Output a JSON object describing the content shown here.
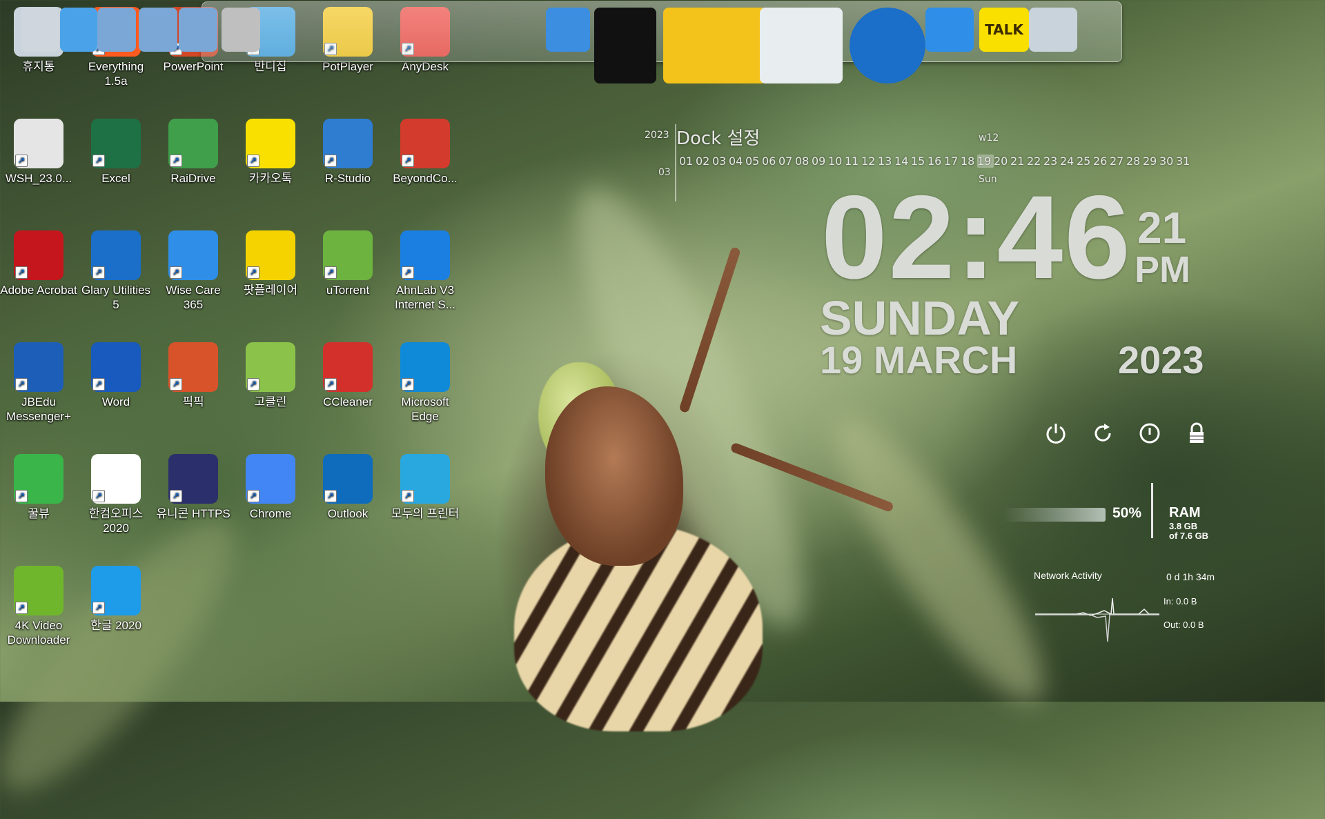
{
  "desktop": {
    "icons": [
      {
        "label": "휴지통",
        "icon": "recycle-bin-icon",
        "color": "#c9d3db"
      },
      {
        "label": "Everything 1.5a",
        "icon": "everything-search-icon",
        "color": "#ff5a1f"
      },
      {
        "label": "PowerPoint",
        "icon": "powerpoint-icon",
        "color": "#d24726"
      },
      {
        "label": "반디집",
        "icon": "bandizip-icon",
        "color": "#3aa0e0"
      },
      {
        "label": "PotPlayer",
        "icon": "potplayer-icon",
        "color": "#f5c518"
      },
      {
        "label": "AnyDesk",
        "icon": "anydesk-icon",
        "color": "#ef443b"
      },
      {
        "label": "WSH_23.0...",
        "icon": "disc-file-icon",
        "color": "#e5e5e5"
      },
      {
        "label": "Excel",
        "icon": "excel-icon",
        "color": "#1e7145"
      },
      {
        "label": "RaiDrive",
        "icon": "raidrive-icon",
        "color": "#3f9f4a"
      },
      {
        "label": "카카오톡",
        "icon": "kakaotalk-icon",
        "color": "#f9e000"
      },
      {
        "label": "R-Studio",
        "icon": "r-studio-icon",
        "color": "#2e7dd1"
      },
      {
        "label": "BeyondCo...",
        "icon": "beyond-compare-icon",
        "color": "#d33b2c"
      },
      {
        "label": "Adobe Acrobat",
        "icon": "acrobat-icon",
        "color": "#c4161c"
      },
      {
        "label": "Glary Utilities 5",
        "icon": "glary-utilities-icon",
        "color": "#1b6fc9"
      },
      {
        "label": "Wise Care 365",
        "icon": "wise-care-icon",
        "color": "#2e8ee8"
      },
      {
        "label": "팟플레이어",
        "icon": "potplayer-play-icon",
        "color": "#f5d300"
      },
      {
        "label": "uTorrent",
        "icon": "utorrent-icon",
        "color": "#6cb33f"
      },
      {
        "label": "AhnLab V3 Internet S...",
        "icon": "ahnlab-v3-icon",
        "color": "#1a7fe0"
      },
      {
        "label": "JBEdu Messenger+",
        "icon": "jbedu-messenger-icon",
        "color": "#1d5fb8"
      },
      {
        "label": "Word",
        "icon": "word-icon",
        "color": "#185abd"
      },
      {
        "label": "픽픽",
        "icon": "picpick-icon",
        "color": "#d9532a"
      },
      {
        "label": "고클린",
        "icon": "goclean-icon",
        "color": "#8bc34a"
      },
      {
        "label": "CCleaner",
        "icon": "ccleaner-icon",
        "color": "#d4302b"
      },
      {
        "label": "Microsoft Edge",
        "icon": "edge-icon",
        "color": "#0f8ad8"
      },
      {
        "label": "꿀뷰",
        "icon": "honeyview-icon",
        "color": "#39b54a"
      },
      {
        "label": "한컴오피스 2020",
        "icon": "hancom-office-icon",
        "color": "#ffffff"
      },
      {
        "label": "유니콘 HTTPS",
        "icon": "unicorn-https-icon",
        "color": "#2b2f6b"
      },
      {
        "label": "Chrome",
        "icon": "chrome-icon",
        "color": "#4285f4"
      },
      {
        "label": "Outlook",
        "icon": "outlook-icon",
        "color": "#0f6cbd"
      },
      {
        "label": "모두의 프린터",
        "icon": "printer-icon",
        "color": "#29a8e0"
      },
      {
        "label": "4K Video Downloader",
        "icon": "4k-video-downloader-icon",
        "color": "#6fb62c"
      },
      {
        "label": "한글 2020",
        "icon": "hangul-icon",
        "color": "#1e9be9"
      }
    ]
  },
  "dock": {
    "items": [
      {
        "icon": "network-computer-icon"
      },
      {
        "icon": "globe-folder-icon"
      },
      {
        "icon": "folder-icon"
      },
      {
        "icon": "folder-icon"
      },
      {
        "icon": "folder-icon"
      },
      {
        "icon": "tools-icon"
      },
      {
        "icon": "globe-icon"
      },
      {
        "icon": "tshirt-icon"
      },
      {
        "icon": "hammer-icon"
      },
      {
        "icon": "recycle-bin-icon"
      },
      {
        "icon": "glary-utilities-icon"
      },
      {
        "icon": "wise-care-icon"
      },
      {
        "icon": "kakaotalk-icon",
        "text": "TALK"
      },
      {
        "icon": "r-studio-icon"
      }
    ]
  },
  "calendar": {
    "year": "2023",
    "month": "03",
    "title": "Dock 설정",
    "week": "w12",
    "days": [
      "01",
      "02",
      "03",
      "04",
      "05",
      "06",
      "07",
      "08",
      "09",
      "10",
      "11",
      "12",
      "13",
      "14",
      "15",
      "16",
      "17",
      "18",
      "19",
      "20",
      "21",
      "22",
      "23",
      "24",
      "25",
      "26",
      "27",
      "28",
      "29",
      "30",
      "31"
    ],
    "current_day_index": 18,
    "day_name": "Sun"
  },
  "clock": {
    "time": "02:46",
    "seconds": "21",
    "ampm": "PM",
    "day": "SUNDAY",
    "date": "19 MARCH",
    "year": "2023"
  },
  "power": {
    "buttons": [
      {
        "icon": "power-icon",
        "glyph": "⏻"
      },
      {
        "icon": "restart-icon",
        "glyph": "⟳"
      },
      {
        "icon": "sleep-icon",
        "glyph": "⏼"
      },
      {
        "icon": "lock-icon",
        "glyph": "🔒"
      }
    ]
  },
  "ram": {
    "percent_label": "50%",
    "percent": 50,
    "label": "RAM",
    "used": "3.8 GB",
    "total": "of 7.6 GB"
  },
  "network": {
    "title": "Network Activity",
    "uptime": "0 d 1h 34m",
    "in": "In: 0.0 B",
    "out": "Out: 0.0 B"
  }
}
